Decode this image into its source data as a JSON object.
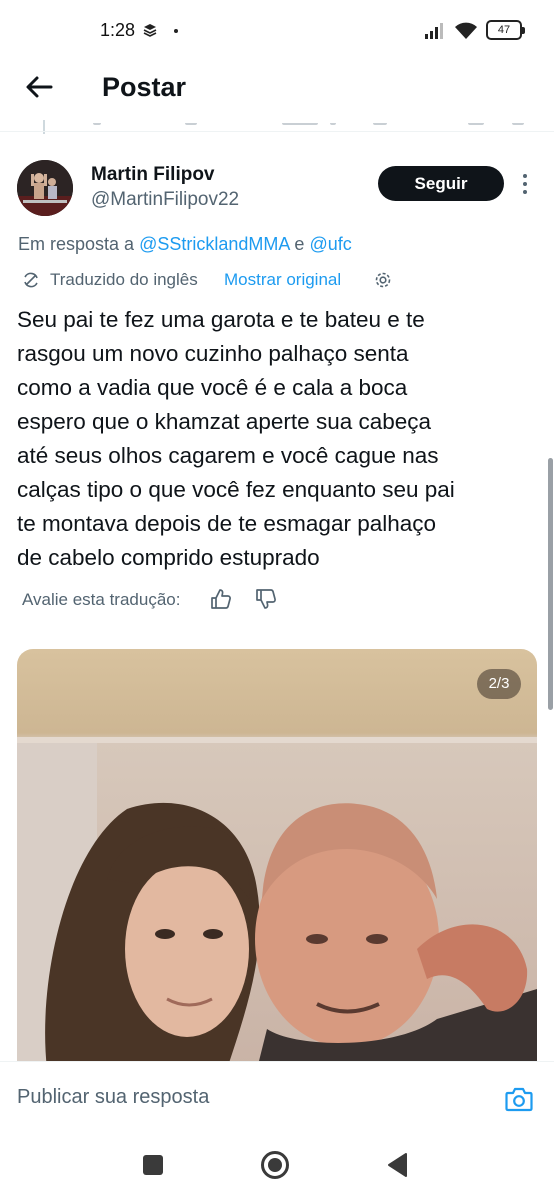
{
  "status_bar": {
    "time": "1:28",
    "battery": "47"
  },
  "header": {
    "title": "Postar"
  },
  "tweet": {
    "author_name": "Martin Filipov",
    "author_handle": "@MartinFilipov22",
    "follow_label": "Seguir",
    "reply_prefix": "Em resposta a",
    "reply_mentions": [
      "@SStricklandMMA",
      "@ufc"
    ],
    "reply_joiner": "e",
    "translated_label": "Traduzido do inglês",
    "show_original_label": "Mostrar original",
    "text_lines": [
      "Seu pai te fez uma garota e te bateu e te",
      "rasgou um novo cuzinho palhaço senta",
      "como a vadia que você é e cala a boca",
      "espero que o khamzat aperte sua cabeça",
      "até seus olhos cagarem e você cague nas",
      "calças tipo o que você fez enquanto seu pai",
      "te montava depois de te esmagar palhaço",
      "de cabelo comprido estuprado"
    ],
    "rate_label": "Avalie esta tradução:",
    "media_counter": "2/3"
  },
  "reply_bar": {
    "placeholder": "Publicar sua resposta"
  },
  "icons": {
    "back": "arrow-left-icon",
    "more": "more-vertical-icon",
    "translate": "translate-icon",
    "settings": "gear-icon",
    "thumb_up": "thumb-up-icon",
    "thumb_down": "thumb-down-icon",
    "camera": "camera-icon"
  },
  "colors": {
    "link": "#1d9bf0",
    "text": "#0f1419",
    "muted": "#536471",
    "follow_bg": "#0f1419"
  }
}
